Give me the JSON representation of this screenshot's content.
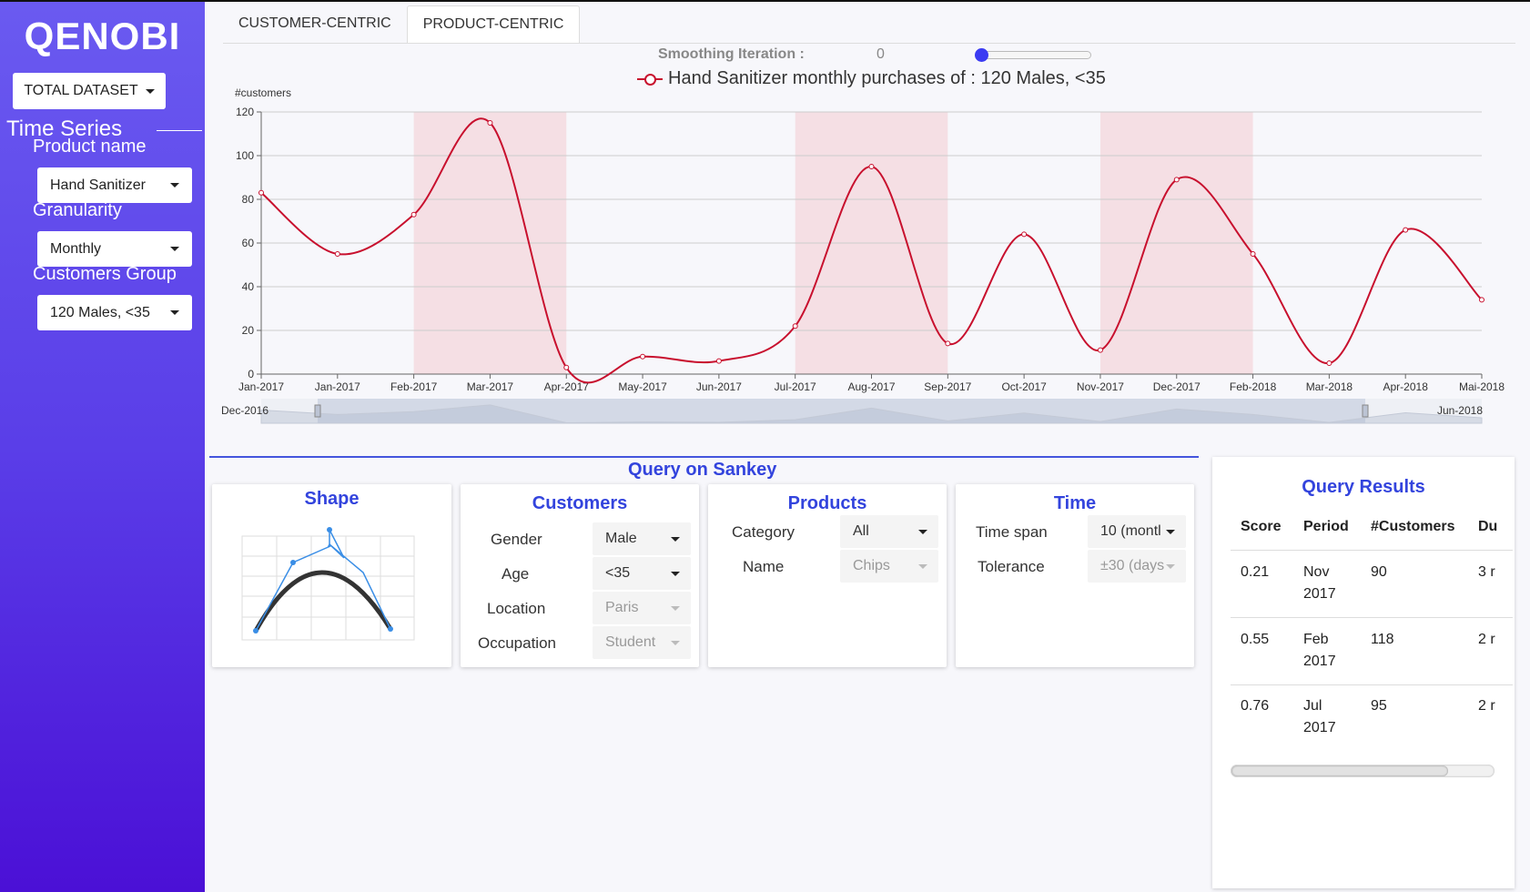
{
  "app": {
    "brand": "QENOBI",
    "dataset_button": "TOTAL DATASET"
  },
  "sidebar": {
    "section": "Time Series",
    "product_label": "Product name",
    "product_value": "Hand Sanitizer",
    "granularity_label": "Granularity",
    "granularity_value": "Monthly",
    "group_label": "Customers Group",
    "group_value": "120 Males, <35"
  },
  "tabs": [
    {
      "label": "CUSTOMER-CENTRIC",
      "active": false
    },
    {
      "label": "PRODUCT-CENTRIC",
      "active": true
    }
  ],
  "smoothing": {
    "label": "Smoothing Iteration :",
    "value": "0"
  },
  "colors": {
    "line": "#c8102e",
    "highlight": "#f5dfe4",
    "accent": "#3344dd",
    "sidebar_top": "#6a5af0",
    "sidebar_bottom": "#4b10d6"
  },
  "chart_data": {
    "type": "line",
    "title": "Hand Sanitizer monthly purchases of : 120 Males, <35",
    "ylabel": "#customers",
    "xlabel": "",
    "ylim": [
      0,
      120
    ],
    "yticks": [
      0,
      20,
      40,
      60,
      80,
      100,
      120
    ],
    "grid": true,
    "categories": [
      "Jan-2017",
      "Jan-2017",
      "Feb-2017",
      "Mar-2017",
      "Apr-2017",
      "May-2017",
      "Jun-2017",
      "Jul-2017",
      "Aug-2017",
      "Sep-2017",
      "Oct-2017",
      "Nov-2017",
      "Dec-2017",
      "Feb-2018",
      "Mar-2018",
      "Apr-2018",
      "Mai-2018"
    ],
    "series": [
      {
        "name": "Hand Sanitizer monthly purchases of : 120 Males, <35",
        "values": [
          83,
          55,
          73,
          115,
          3,
          8,
          6,
          22,
          95,
          14,
          64,
          11,
          89,
          55,
          5,
          66,
          34
        ]
      }
    ],
    "highlight_ranges": [
      [
        2,
        4
      ],
      [
        7,
        9
      ],
      [
        11,
        13
      ]
    ],
    "navigator": {
      "start_label": "Dec-2016",
      "end_label": "Jun-2018"
    }
  },
  "query": {
    "title": "Query on Sankey",
    "shape": {
      "title": "Shape"
    },
    "customers": {
      "title": "Customers",
      "rows": [
        {
          "label": "Gender",
          "value": "Male",
          "disabled": false
        },
        {
          "label": "Age",
          "value": "<35",
          "disabled": false
        },
        {
          "label": "Location",
          "value": "Paris",
          "disabled": true
        },
        {
          "label": "Occupation",
          "value": "Student",
          "disabled": true
        }
      ]
    },
    "products": {
      "title": "Products",
      "rows": [
        {
          "label": "Category",
          "value": "All",
          "disabled": false
        },
        {
          "label": "Name",
          "value": "Chips",
          "disabled": true
        }
      ]
    },
    "time": {
      "title": "Time",
      "rows": [
        {
          "label": "Time span",
          "value": "10 (montl",
          "disabled": false
        },
        {
          "label": "Tolerance",
          "value": "±30 (days",
          "disabled": true
        }
      ]
    }
  },
  "results": {
    "title": "Query Results",
    "columns": [
      "Score",
      "Period",
      "#Customers",
      "Du"
    ],
    "rows": [
      {
        "score": "0.21",
        "period_1": "Nov",
        "period_2": "2017",
        "customers": "90",
        "duration": "3 r"
      },
      {
        "score": "0.55",
        "period_1": "Feb",
        "period_2": "2017",
        "customers": "118",
        "duration": "2 r"
      },
      {
        "score": "0.76",
        "period_1": "Jul",
        "period_2": "2017",
        "customers": "95",
        "duration": "2 r"
      }
    ]
  }
}
